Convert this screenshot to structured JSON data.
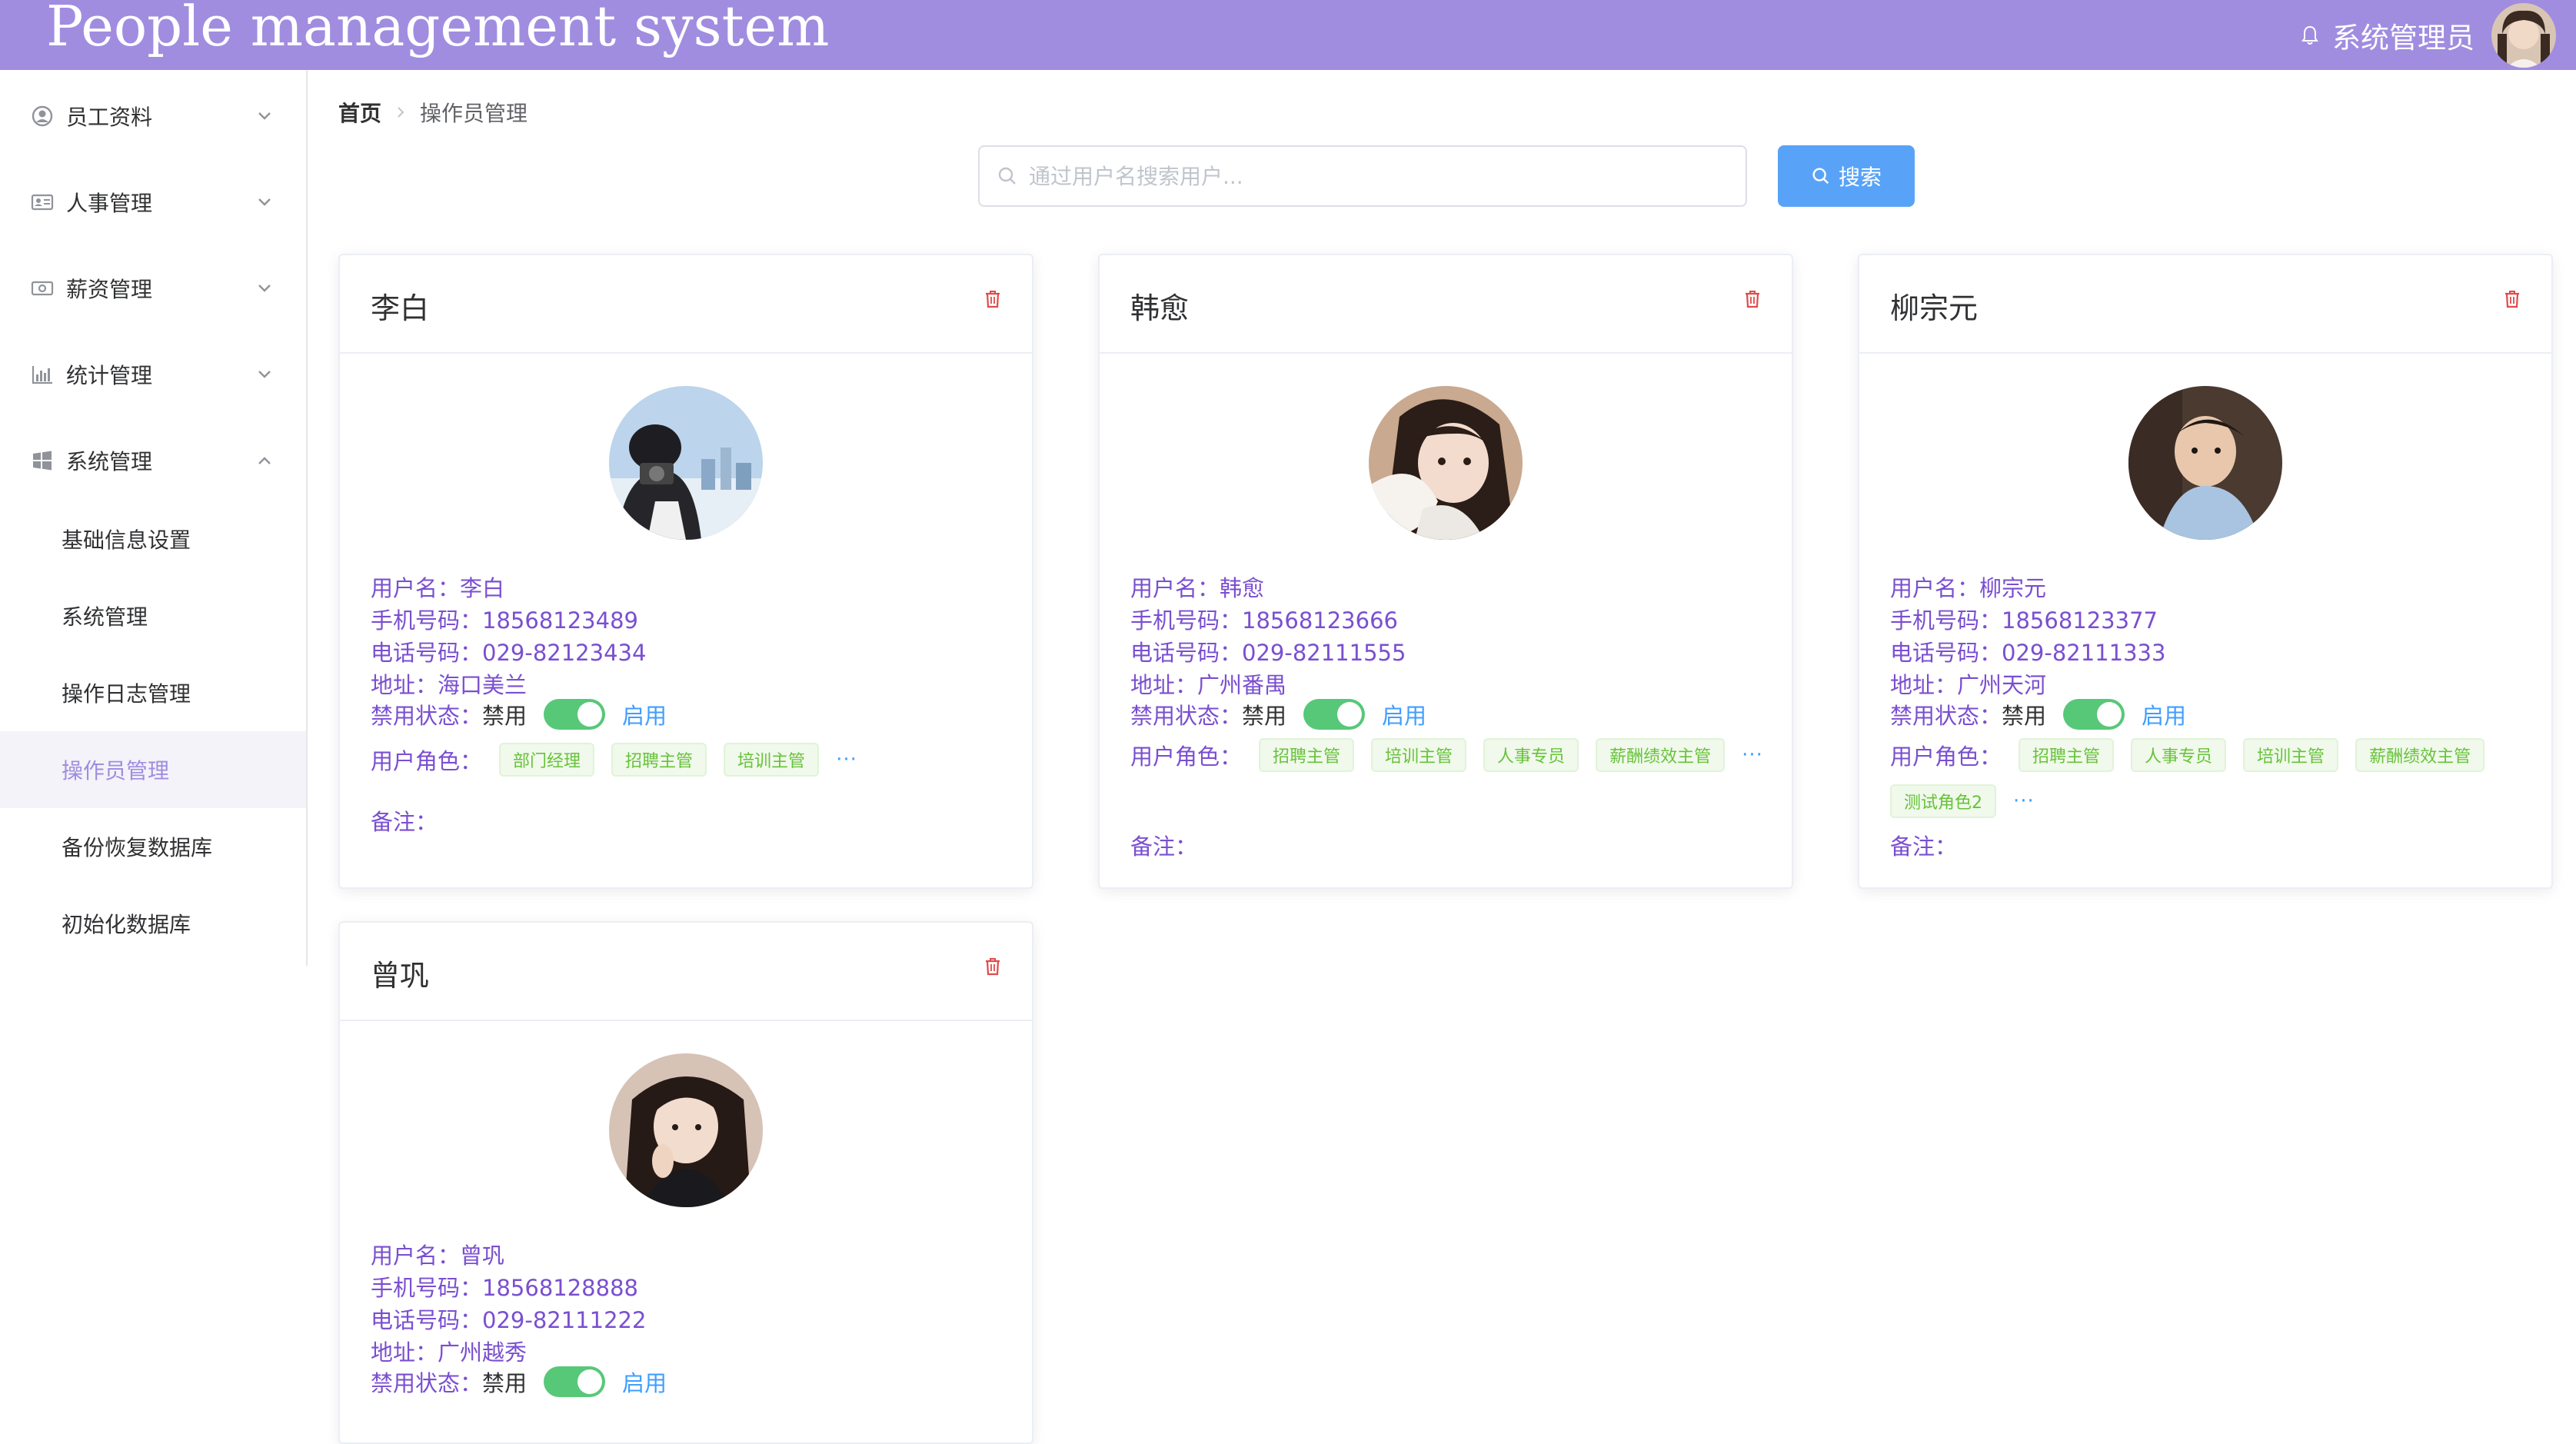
{
  "header": {
    "title": "People management system",
    "user_name": "系统管理员",
    "bg_color": "#a08de0",
    "bell_icon": "bell-icon"
  },
  "sidebar": {
    "menus": [
      {
        "label": "员工资料",
        "icon": "user-circle-icon",
        "expanded": false
      },
      {
        "label": "人事管理",
        "icon": "id-card-icon",
        "expanded": false
      },
      {
        "label": "薪资管理",
        "icon": "money-icon",
        "expanded": false
      },
      {
        "label": "统计管理",
        "icon": "bar-chart-icon",
        "expanded": false
      },
      {
        "label": "系统管理",
        "icon": "windows-icon",
        "expanded": true
      }
    ],
    "submenu": [
      {
        "label": "基础信息设置"
      },
      {
        "label": "系统管理"
      },
      {
        "label": "操作日志管理"
      },
      {
        "label": "操作员管理",
        "active": true
      },
      {
        "label": "备份恢复数据库"
      },
      {
        "label": "初始化数据库"
      }
    ]
  },
  "breadcrumb": {
    "home": "首页",
    "current": "操作员管理"
  },
  "search": {
    "placeholder": "通过用户名搜索用户...",
    "value": "",
    "button_label": "搜索"
  },
  "labels": {
    "username": "用户名：",
    "mobile": "手机号码：",
    "phone": "电话号码：",
    "address": "地址：",
    "status": "禁用状态：",
    "status_off": "禁用",
    "status_on": "启用",
    "roles": "用户角色：",
    "more": "···",
    "remark": "备注："
  },
  "operators": [
    {
      "name": "李白",
      "mobile": "18568123489",
      "phone": "029-82123434",
      "address": "海口美兰",
      "enabled": true,
      "roles": [
        "部门经理",
        "招聘主管",
        "培训主管"
      ],
      "remark": ""
    },
    {
      "name": "韩愈",
      "mobile": "18568123666",
      "phone": "029-82111555",
      "address": "广州番禺",
      "enabled": true,
      "roles": [
        "招聘主管",
        "培训主管",
        "人事专员",
        "薪酬绩效主管"
      ],
      "remark": ""
    },
    {
      "name": "柳宗元",
      "mobile": "18568123377",
      "phone": "029-82111333",
      "address": "广州天河",
      "enabled": true,
      "roles": [
        "招聘主管",
        "人事专员",
        "培训主管",
        "薪酬绩效主管",
        "测试角色2"
      ],
      "remark": ""
    },
    {
      "name": "曾巩",
      "mobile": "18568128888",
      "phone": "029-82111222",
      "address": "广州越秀",
      "enabled": true,
      "roles": [],
      "remark": ""
    }
  ],
  "colors": {
    "accent": "#a08de0",
    "info_text": "#7a4fd0",
    "switch_on": "#57c878",
    "tag_text": "#67c23a",
    "link": "#409eff",
    "search_button": "#58a3f7",
    "delete": "#e04b4b"
  }
}
